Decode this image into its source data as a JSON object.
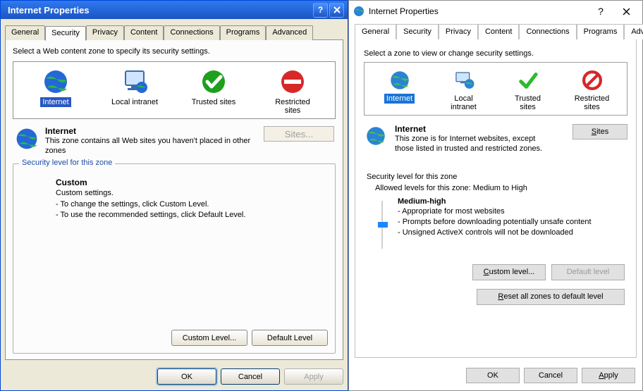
{
  "left": {
    "title": "Internet Properties",
    "tabs": [
      "General",
      "Security",
      "Privacy",
      "Content",
      "Connections",
      "Programs",
      "Advanced"
    ],
    "active_tab": 1,
    "instruction": "Select a Web content zone to specify its security settings.",
    "zones": [
      {
        "label": "Internet",
        "icon": "globe"
      },
      {
        "label": "Local intranet",
        "icon": "monitor"
      },
      {
        "label": "Trusted sites",
        "icon": "check-circle"
      },
      {
        "label": "Restricted sites",
        "icon": "no-entry"
      }
    ],
    "selected_zone": 0,
    "detail": {
      "name": "Internet",
      "desc": "This zone contains all Web sites you haven't placed in other zones"
    },
    "sites_button": "Sites...",
    "group_label": "Security level for this zone",
    "custom": {
      "name": "Custom",
      "desc": "Custom settings.",
      "line1": "- To change the settings, click Custom Level.",
      "line2": "- To use the recommended settings, click Default Level."
    },
    "custom_level_btn": "Custom Level...",
    "default_level_btn": "Default Level",
    "ok": "OK",
    "cancel": "Cancel",
    "apply": "Apply"
  },
  "right": {
    "title": "Internet Properties",
    "tabs": [
      "General",
      "Security",
      "Privacy",
      "Content",
      "Connections",
      "Programs",
      "Advanced"
    ],
    "active_tab": 1,
    "instruction": "Select a zone to view or change security settings.",
    "zones": [
      {
        "label": "Internet",
        "icon": "globe"
      },
      {
        "label": "Local intranet",
        "icon": "monitor"
      },
      {
        "label": "Trusted sites",
        "icon": "check"
      },
      {
        "label": "Restricted sites",
        "icon": "no-sign"
      }
    ],
    "selected_zone": 0,
    "detail": {
      "name": "Internet",
      "desc": "This zone is for Internet websites, except those listed in trusted and restricted zones."
    },
    "sites_button": "Sites",
    "group_label": "Security level for this zone",
    "allowed": "Allowed levels for this zone: Medium to High",
    "level": {
      "name": "Medium-high",
      "line1": "- Appropriate for most websites",
      "line2": "- Prompts before downloading potentially unsafe content",
      "line3": "- Unsigned ActiveX controls will not be downloaded"
    },
    "custom_level_btn": "Custom level...",
    "default_level_btn": "Default level",
    "reset_btn": "Reset all zones to default level",
    "ok": "OK",
    "cancel": "Cancel",
    "apply": "Apply"
  }
}
